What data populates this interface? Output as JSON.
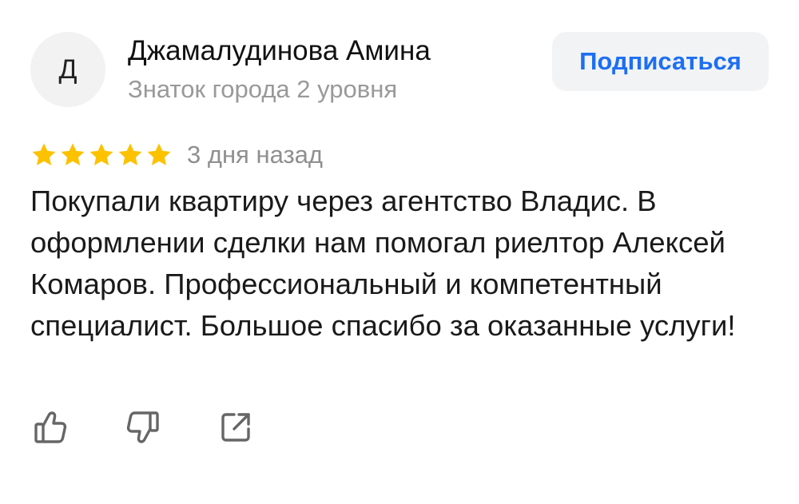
{
  "author": {
    "avatar_letter": "Д",
    "name": "Джамалудинова Амина",
    "level": "Знаток города 2 уровня"
  },
  "subscribe": {
    "label": "Подписаться",
    "color": "#1d6ff2"
  },
  "review": {
    "rating": 5,
    "rating_max": 5,
    "star_color": "#fcc200",
    "date": "3 дня назад",
    "text": "Покупали квартиру через агентство Владис. В оформлении сделки нам помогал риелтор Алексей Комаров. Профессиональный и компетентный специалист. Большое спасибо за оказанные услуги!"
  },
  "actions": [
    {
      "icon": "thumbs-up-icon"
    },
    {
      "icon": "thumbs-down-icon"
    },
    {
      "icon": "share-icon"
    }
  ],
  "colors": {
    "text_secondary": "#999999",
    "icon_color": "#666666"
  }
}
